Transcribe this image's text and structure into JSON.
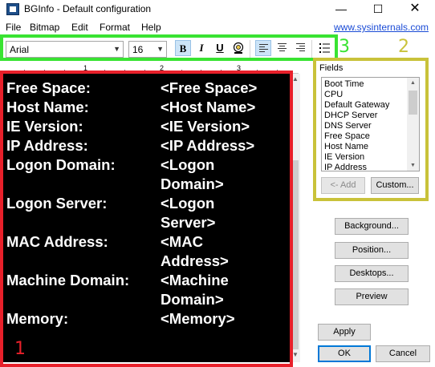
{
  "window": {
    "title": "BGInfo - Default configuration",
    "minimize_glyph": "—",
    "maximize_glyph": "☐",
    "close_glyph": "✕",
    "app_icon": "bginfo-app-icon"
  },
  "menu": {
    "items": [
      "File",
      "Bitmap",
      "Edit",
      "Format",
      "Help"
    ],
    "link": "www.sysinternals.com"
  },
  "toolbar": {
    "font": "Arial",
    "size": "16",
    "bold": "B",
    "italic": "I",
    "underline": "U",
    "font_color_icon": "font-color-icon",
    "align_left_pressed": true,
    "bold_pressed": true
  },
  "ruler": {
    "labels": [
      "1",
      "2",
      "3"
    ]
  },
  "editor": {
    "text_color": "#ffffff",
    "background": "#000000",
    "rows": [
      {
        "key": "Free Space:",
        "value": "<Free Space>"
      },
      {
        "key": "Host Name:",
        "value": "<Host Name>"
      },
      {
        "key": "IE Version:",
        "value": "<IE Version>"
      },
      {
        "key": "IP Address:",
        "value": "<IP Address>"
      },
      {
        "key": "Logon Domain:",
        "value": "<Logon\nDomain>"
      },
      {
        "key": "Logon Server:",
        "value": "<Logon\nServer>"
      },
      {
        "key": "MAC Address:",
        "value": "<MAC\nAddress>"
      },
      {
        "key": "Machine Domain:",
        "value": "<Machine\nDomain>"
      },
      {
        "key": "Memory:",
        "value": "<Memory>"
      }
    ]
  },
  "fields": {
    "label": "Fields",
    "items": [
      "Boot Time",
      "CPU",
      "Default Gateway",
      "DHCP Server",
      "DNS Server",
      "Free Space",
      "Host Name",
      "IE Version",
      "IP Address"
    ],
    "add_button": "<- Add",
    "custom_button": "Custom..."
  },
  "side_buttons": {
    "background": "Background...",
    "position": "Position...",
    "desktops": "Desktops...",
    "preview": "Preview"
  },
  "footer_buttons": {
    "apply": "Apply",
    "ok": "OK",
    "cancel": "Cancel"
  },
  "annotations": {
    "red": {
      "label": "1",
      "color": "#e8202a"
    },
    "yellow": {
      "label": "2",
      "color": "#c9c23a"
    },
    "green": {
      "label": "3",
      "color": "#39e332"
    }
  }
}
